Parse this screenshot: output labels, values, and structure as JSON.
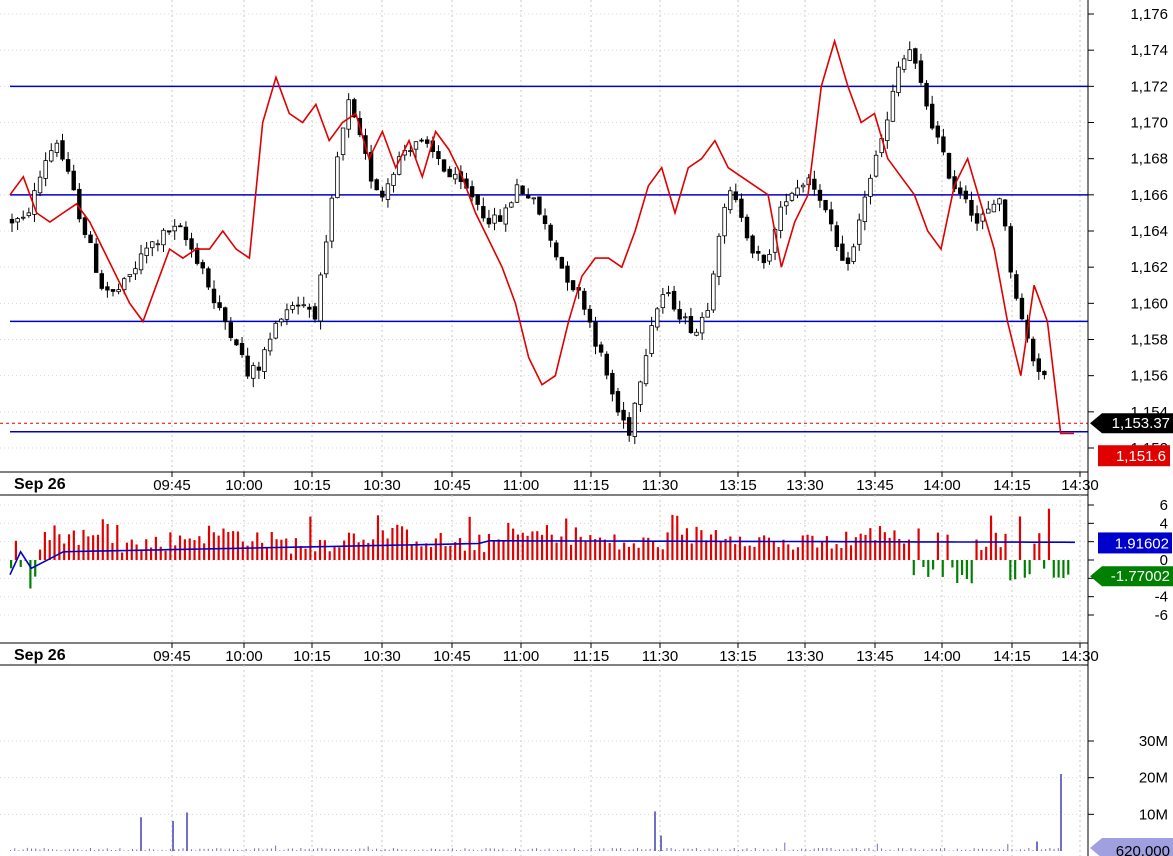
{
  "chart_data": [
    {
      "type": "candlestick",
      "panel": "price",
      "date_label": "Sep 26",
      "x_ticks": [
        "09:45",
        "10:00",
        "10:15",
        "10:30",
        "10:45",
        "11:00",
        "11:15",
        "11:30",
        "13:15",
        "13:30",
        "13:45",
        "14:00",
        "14:15",
        "14:30"
      ],
      "y_ticks": [
        "1,152",
        "1,154",
        "1,156",
        "1,158",
        "1,160",
        "1,162",
        "1,164",
        "1,166",
        "1,168",
        "1,170",
        "1,172",
        "1,174",
        "1,176"
      ],
      "ylim": [
        1151,
        1176.5
      ],
      "close_path": [
        1164.6,
        1164.5,
        1166.0,
        1168.0,
        1169.0,
        1167.0,
        1165.0,
        1163.0,
        1161.0,
        1160.5,
        1161.0,
        1162.0,
        1163.0,
        1163.5,
        1164.0,
        1164.0,
        1163.0,
        1162.0,
        1160.0,
        1159.0,
        1158.0,
        1156.0,
        1156.5,
        1158.0,
        1159.5,
        1160.0,
        1160.0,
        1159.5,
        1163.0,
        1168.0,
        1171.0,
        1169.0,
        1167.0,
        1166.0,
        1167.5,
        1168.5,
        1169.0,
        1168.5,
        1168.0,
        1167.0,
        1166.5,
        1166.0,
        1165.0,
        1164.5,
        1165.0,
        1166.5,
        1166.0,
        1165.0,
        1163.5,
        1162.0,
        1161.0,
        1160.0,
        1158.0,
        1156.0,
        1154.0,
        1153.0,
        1156.0,
        1159.0,
        1160.5,
        1160.0,
        1159.0,
        1158.5,
        1160.0,
        1164.0,
        1166.0,
        1165.0,
        1163.0,
        1162.0,
        1164.0,
        1166.0,
        1166.5,
        1167.0,
        1166.0,
        1164.0,
        1162.0,
        1163.0,
        1166.0,
        1168.0,
        1170.0,
        1173.0,
        1174.0,
        1172.0,
        1170.0,
        1168.0,
        1166.5,
        1166.0,
        1164.5,
        1165.0,
        1166.0,
        1162.0,
        1159.0,
        1157.0,
        1156.0
      ],
      "ma_line": [
        1166.0,
        1167.0,
        1165.0,
        1164.5,
        1165.0,
        1165.5,
        1164.5,
        1163.0,
        1161.5,
        1160.0,
        1159.0,
        1161.0,
        1163.0,
        1162.5,
        1163.0,
        1163.0,
        1164.0,
        1163.0,
        1162.5,
        1170.0,
        1172.5,
        1170.5,
        1170.0,
        1171.0,
        1169.0,
        1170.0,
        1170.5,
        1168.0,
        1169.5,
        1167.5,
        1169.0,
        1167.0,
        1169.5,
        1168.5,
        1167.0,
        1165.0,
        1163.5,
        1162.0,
        1160.0,
        1157.0,
        1155.5,
        1156.0,
        1159.0,
        1161.5,
        1162.5,
        1162.5,
        1162.0,
        1164.0,
        1166.5,
        1167.5,
        1165.0,
        1167.5,
        1168.0,
        1169.0,
        1167.5,
        1167.0,
        1166.5,
        1166.0,
        1162.0,
        1164.5,
        1166.0,
        1172.0,
        1174.5,
        1172.0,
        1170.0,
        1170.5,
        1168.0,
        1167.0,
        1166.0,
        1164.0,
        1163.0,
        1166.5,
        1168.0,
        1165.5,
        1163.0,
        1159.0,
        1156.0,
        1161.0,
        1159.0,
        1152.8,
        1152.8
      ],
      "levels": [
        1172.0,
        1166.0,
        1159.0,
        1152.9
      ],
      "last_price_label": "1,153.37",
      "last_price": 1153.37,
      "ma_label": "1,151.6",
      "ma_value": 1151.6,
      "colors": {
        "level": "#0000cc",
        "ma": "#e00000",
        "up": "#ffffff",
        "down": "#000000"
      }
    },
    {
      "type": "bar",
      "panel": "oscillator",
      "date_label": "Sep 26",
      "x_ticks": [
        "09:45",
        "10:00",
        "10:15",
        "10:30",
        "10:45",
        "11:00",
        "11:15",
        "11:30",
        "13:15",
        "13:30",
        "13:45",
        "14:00",
        "14:15",
        "14:30"
      ],
      "y_ticks": [
        "6",
        "4",
        "2",
        "0",
        "-2",
        "-4",
        "-6"
      ],
      "ylim": [
        -6.5,
        6.5
      ],
      "signal_label": "1.91602",
      "signal_value": 1.91602,
      "value_label": "-1.77002",
      "value": -1.77002,
      "colors": {
        "positive": "#e00000",
        "negative": "#008000",
        "signal": "#0000cc"
      }
    },
    {
      "type": "bar",
      "panel": "volume",
      "y_ticks": [
        "10M",
        "20M",
        "30M"
      ],
      "ylim": [
        0,
        35000000
      ],
      "last_volume_label": "620,000",
      "last_volume": 620000,
      "colors": {
        "bar": "#7070c8"
      }
    }
  ]
}
